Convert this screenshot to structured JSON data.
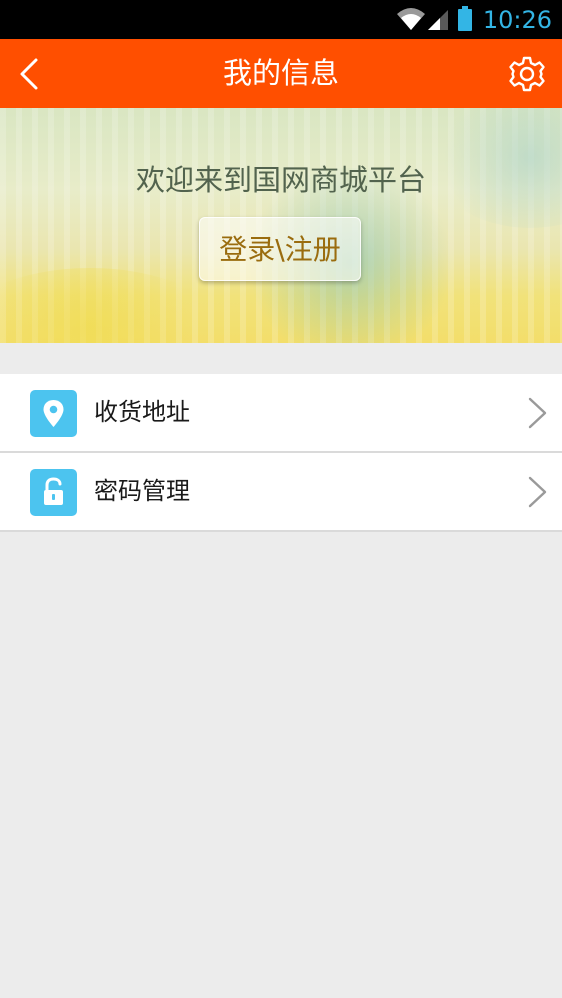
{
  "status_bar": {
    "time": "10:26",
    "icons": [
      "wifi-icon",
      "signal-icon",
      "battery-icon"
    ],
    "clock_color": "#33b5e5"
  },
  "header": {
    "title": "我的信息",
    "back_icon": "chevron-left-icon",
    "settings_icon": "gear-icon",
    "background": "#ff4f00"
  },
  "banner": {
    "welcome_text": "欢迎来到国网商城平台",
    "login_label": "登录\\注册"
  },
  "menu": {
    "items": [
      {
        "label": "收货地址",
        "icon": "location-pin-icon"
      },
      {
        "label": "密码管理",
        "icon": "lock-icon"
      }
    ],
    "icon_color": "#4cc4ef"
  }
}
